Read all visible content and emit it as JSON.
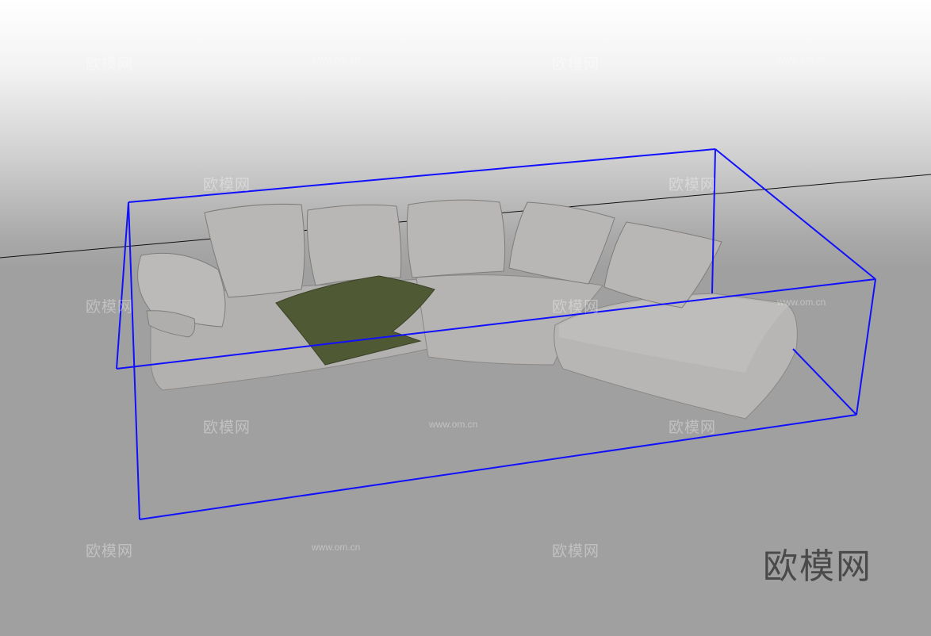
{
  "watermark": {
    "brand": "欧模网",
    "url": "www.om.cn"
  },
  "logo": {
    "text": "欧模网"
  },
  "colors": {
    "bounding_box": "#1010ff",
    "sofa": "#b4b2b0",
    "throw": "#4f5a35",
    "floor": "#a0a0a0"
  }
}
